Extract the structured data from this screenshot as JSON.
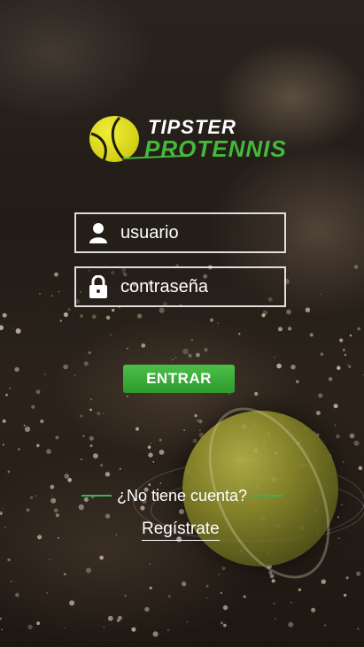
{
  "logo": {
    "line1": "TIPSTER",
    "line2": "PROTENNIS",
    "ball_color": "#d8d41a",
    "accent": "#45b93a"
  },
  "login": {
    "username_placeholder": "usuario",
    "password_placeholder": "contraseña",
    "submit_label": "ENTRAR",
    "user_icon": "user-icon",
    "lock_icon": "lock-icon"
  },
  "signup": {
    "prompt": "¿No tiene cuenta?",
    "link_label": "Regístrate"
  },
  "colors": {
    "button": "#3aae3a",
    "divider": "#35b45a"
  }
}
